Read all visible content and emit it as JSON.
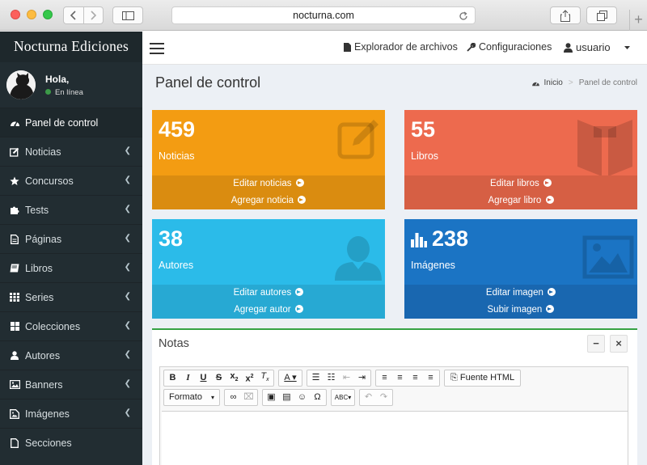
{
  "browser": {
    "url": "nocturna.com"
  },
  "sidebar": {
    "brand": "Nocturna Ediciones",
    "user_greeting": "Hola,",
    "user_status": "En línea",
    "items": [
      {
        "label": "Panel de control",
        "icon": "dashboard-icon",
        "active": true
      },
      {
        "label": "Noticias",
        "icon": "edit-icon"
      },
      {
        "label": "Concursos",
        "icon": "star-icon"
      },
      {
        "label": "Tests",
        "icon": "puzzle-icon"
      },
      {
        "label": "Páginas",
        "icon": "file-icon"
      },
      {
        "label": "Libros",
        "icon": "book-icon"
      },
      {
        "label": "Series",
        "icon": "th-icon"
      },
      {
        "label": "Colecciones",
        "icon": "th-large-icon"
      },
      {
        "label": "Autores",
        "icon": "user-icon"
      },
      {
        "label": "Banners",
        "icon": "image-icon"
      },
      {
        "label": "Imágenes",
        "icon": "images-icon"
      },
      {
        "label": "Secciones",
        "icon": "file-icon"
      }
    ]
  },
  "topbar": {
    "file_explorer": "Explorador de archivos",
    "settings": "Configuraciones",
    "user": "usuario"
  },
  "page": {
    "title": "Panel de control",
    "breadcrumb_home": "Inicio",
    "breadcrumb_current": "Panel de control"
  },
  "stats": [
    {
      "value": "459",
      "label": "Noticias",
      "link1": "Editar noticias",
      "link2": "Agregar noticia",
      "color": "#f39c12"
    },
    {
      "value": "55",
      "label": "Libros",
      "link1": "Editar libros",
      "link2": "Agregar libro",
      "color": "#ed6a4e"
    },
    {
      "value": "38",
      "label": "Autores",
      "link1": "Editar autores",
      "link2": "Agregar autor",
      "color": "#2bbbe9"
    },
    {
      "value": "238",
      "label": "Imágenes",
      "link1": "Editar imagen",
      "link2": "Subir imagen",
      "color": "#1b74c4"
    }
  ],
  "notes": {
    "title": "Notas",
    "minimize": "−",
    "close": "×",
    "source_html": "Fuente HTML",
    "format": "Formato"
  }
}
